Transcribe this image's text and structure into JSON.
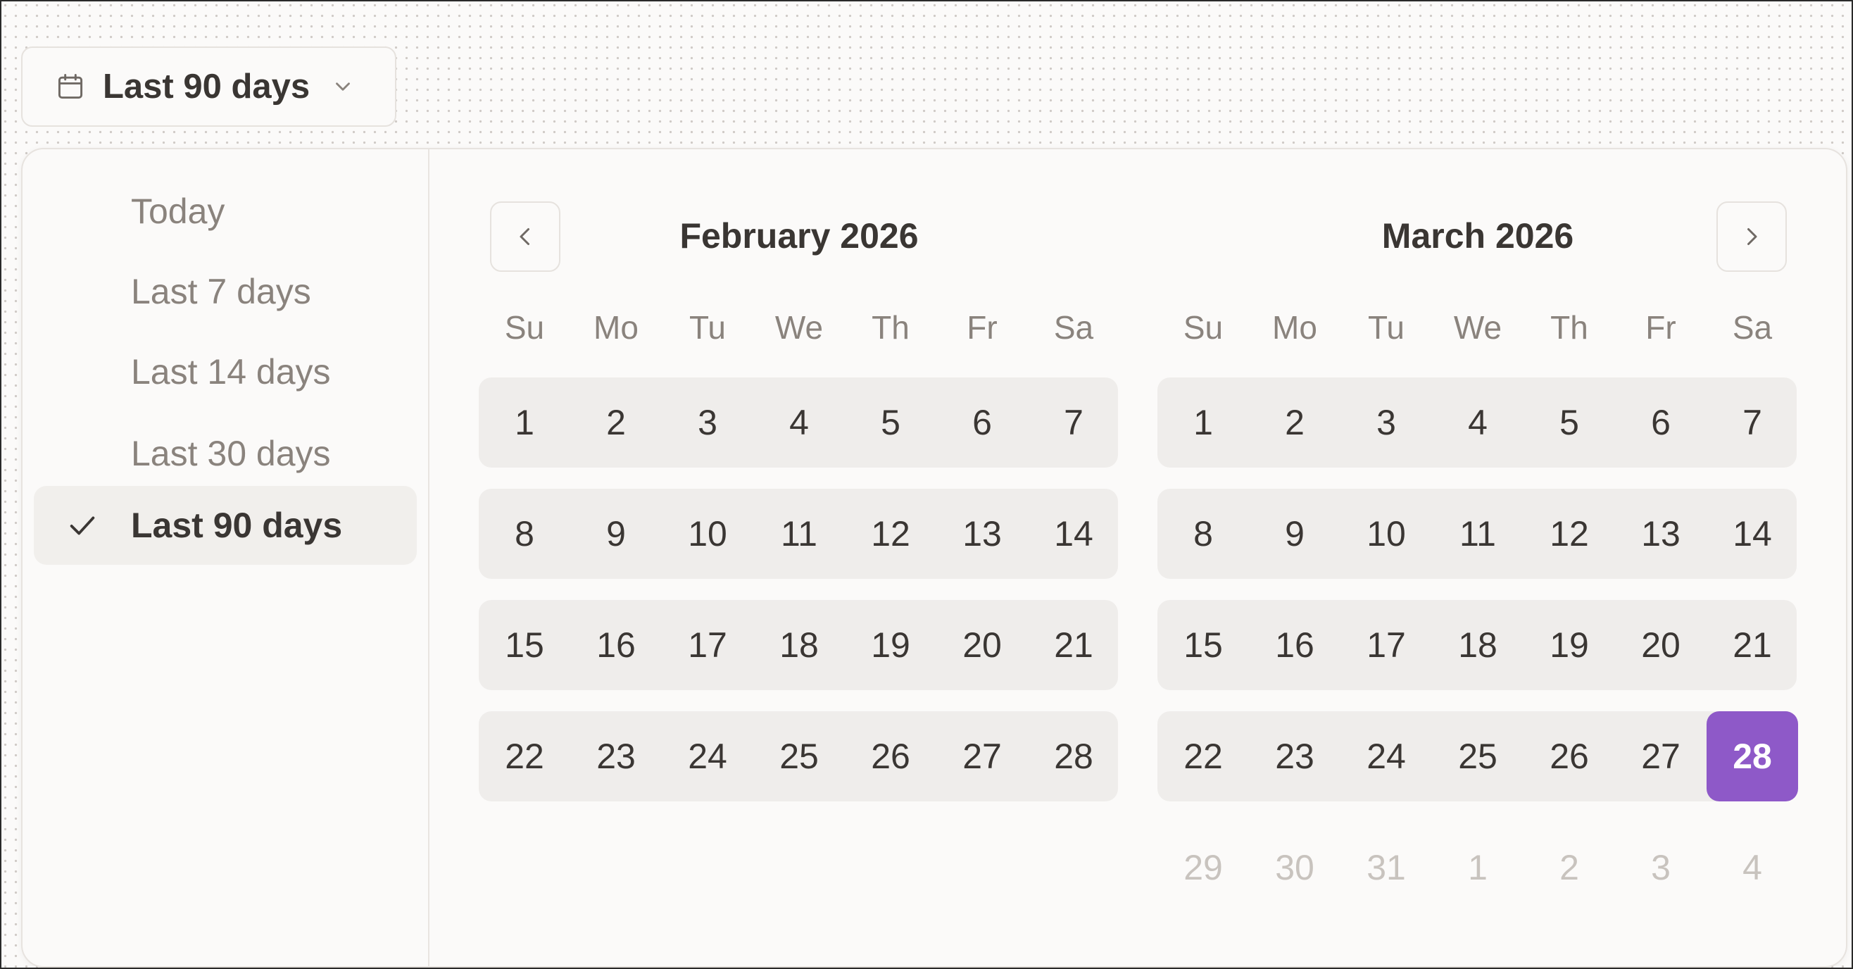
{
  "trigger": {
    "label": "Last 90 days",
    "icon": "calendar-icon",
    "chevron": "chevron-down-icon"
  },
  "presets": {
    "items": [
      {
        "label": "Today",
        "active": false
      },
      {
        "label": "Last 7 days",
        "active": false
      },
      {
        "label": "Last 14 days",
        "active": false
      },
      {
        "label": "Last 30 days",
        "active": false
      },
      {
        "label": "Last 90 days",
        "active": true
      }
    ]
  },
  "calendar": {
    "prev_icon": "chevron-left-icon",
    "next_icon": "chevron-right-icon",
    "weekdays": [
      "Su",
      "Mo",
      "Tu",
      "We",
      "Th",
      "Fr",
      "Sa"
    ],
    "selected_color": "#8e59c8",
    "months": [
      {
        "title": "February 2026",
        "weeks": [
          [
            "1",
            "2",
            "3",
            "4",
            "5",
            "6",
            "7"
          ],
          [
            "8",
            "9",
            "10",
            "11",
            "12",
            "13",
            "14"
          ],
          [
            "15",
            "16",
            "17",
            "18",
            "19",
            "20",
            "21"
          ],
          [
            "22",
            "23",
            "24",
            "25",
            "26",
            "27",
            "28"
          ]
        ],
        "outside_days": []
      },
      {
        "title": "March 2026",
        "weeks": [
          [
            "1",
            "2",
            "3",
            "4",
            "5",
            "6",
            "7"
          ],
          [
            "8",
            "9",
            "10",
            "11",
            "12",
            "13",
            "14"
          ],
          [
            "15",
            "16",
            "17",
            "18",
            "19",
            "20",
            "21"
          ],
          [
            "22",
            "23",
            "24",
            "25",
            "26",
            "27",
            "28"
          ]
        ],
        "outside_days": [
          "29",
          "30",
          "31",
          "1",
          "2",
          "3",
          "4"
        ],
        "selected_day": "28"
      }
    ]
  }
}
